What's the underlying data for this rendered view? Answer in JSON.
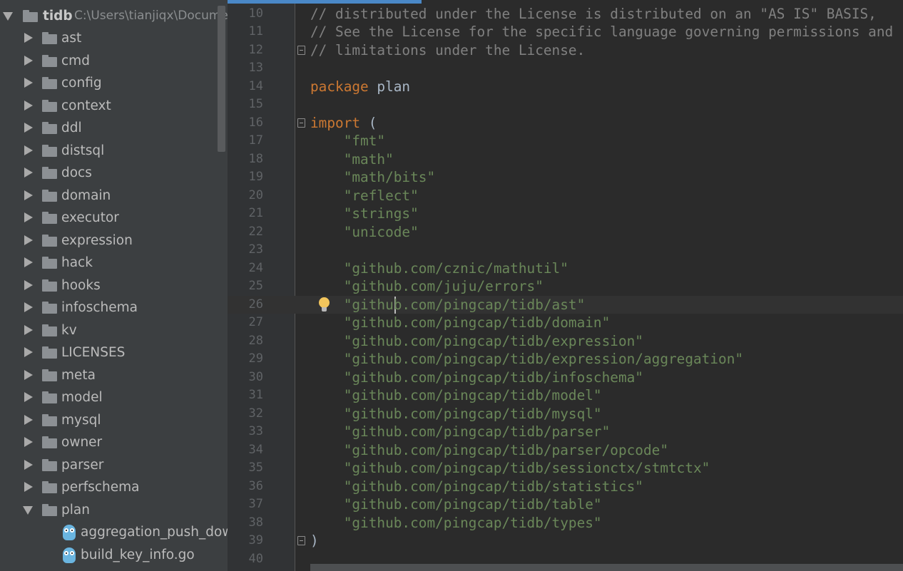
{
  "project": {
    "root_name": "tidb",
    "root_path": "C:\\Users\\tianjiqx\\Docume",
    "folders": [
      "ast",
      "cmd",
      "config",
      "context",
      "ddl",
      "distsql",
      "docs",
      "domain",
      "executor",
      "expression",
      "hack",
      "hooks",
      "infoschema",
      "kv",
      "LICENSES",
      "meta",
      "model",
      "mysql",
      "owner",
      "parser",
      "perfschema",
      "plan"
    ],
    "files": [
      "aggregation_push_down_",
      "build_key_info.go"
    ]
  },
  "editor": {
    "lines": [
      {
        "n": "10",
        "t": "// distributed under the License is distributed on an \"AS IS\" BASIS,"
      },
      {
        "n": "11",
        "t": "// See the License for the specific language governing permissions and"
      },
      {
        "n": "12",
        "t": "// limitations under the License."
      },
      {
        "n": "13",
        "t": ""
      },
      {
        "n": "14",
        "t": "package",
        "t2": " plan"
      },
      {
        "n": "15",
        "t": ""
      },
      {
        "n": "16",
        "t": "import",
        "t2": " ("
      },
      {
        "n": "17",
        "t": "    \"fmt\""
      },
      {
        "n": "18",
        "t": "    \"math\""
      },
      {
        "n": "19",
        "t": "    \"math/bits\""
      },
      {
        "n": "20",
        "t": "    \"reflect\""
      },
      {
        "n": "21",
        "t": "    \"strings\""
      },
      {
        "n": "22",
        "t": "    \"unicode\""
      },
      {
        "n": "23",
        "t": ""
      },
      {
        "n": "24",
        "t": "    \"github.com/cznic/mathutil\""
      },
      {
        "n": "25",
        "t": "    \"github.com/juju/errors\""
      },
      {
        "n": "26",
        "t": "    \"github.com/pingcap/tidb/ast\""
      },
      {
        "n": "27",
        "t": "    \"github.com/pingcap/tidb/domain\""
      },
      {
        "n": "28",
        "t": "    \"github.com/pingcap/tidb/expression\""
      },
      {
        "n": "29",
        "t": "    \"github.com/pingcap/tidb/expression/aggregation\""
      },
      {
        "n": "30",
        "t": "    \"github.com/pingcap/tidb/infoschema\""
      },
      {
        "n": "31",
        "t": "    \"github.com/pingcap/tidb/model\""
      },
      {
        "n": "32",
        "t": "    \"github.com/pingcap/tidb/mysql\""
      },
      {
        "n": "33",
        "t": "    \"github.com/pingcap/tidb/parser\""
      },
      {
        "n": "34",
        "t": "    \"github.com/pingcap/tidb/parser/opcode\""
      },
      {
        "n": "35",
        "t": "    \"github.com/pingcap/tidb/sessionctx/stmtctx\""
      },
      {
        "n": "36",
        "t": "    \"github.com/pingcap/tidb/statistics\""
      },
      {
        "n": "37",
        "t": "    \"github.com/pingcap/tidb/table\""
      },
      {
        "n": "38",
        "t": "    \"github.com/pingcap/tidb/types\""
      },
      {
        "n": "39",
        "t": ")"
      },
      {
        "n": "40",
        "t": ""
      }
    ]
  },
  "colors": {
    "keyword": "#cc7832",
    "string": "#6a8759",
    "comment": "#808080",
    "text": "#a9b7c6"
  },
  "icons": {
    "folder": "folder-icon",
    "go_file": "gopher-icon",
    "intention": "lightbulb-icon"
  }
}
